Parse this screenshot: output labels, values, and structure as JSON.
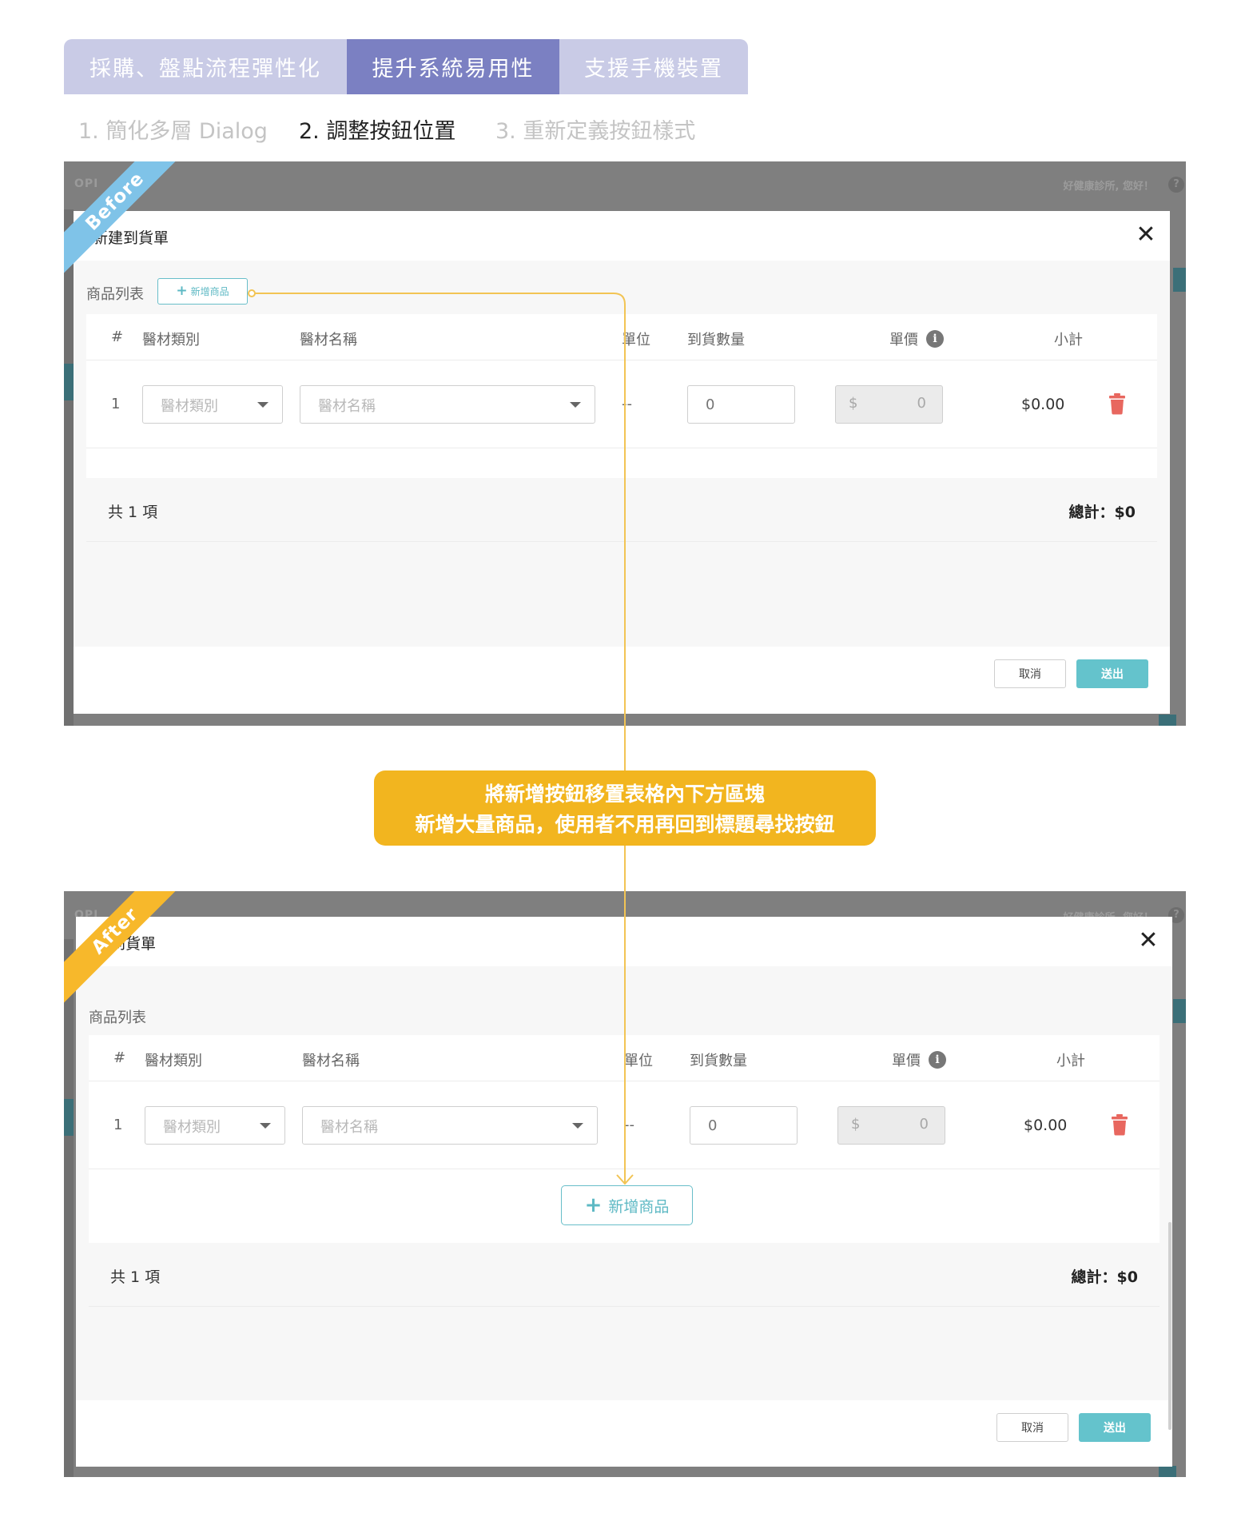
{
  "top_tabs": [
    "採購、盤點流程彈性化",
    "提升系統易用性",
    "支援手機裝置"
  ],
  "sub_steps": [
    "1. 簡化多層 Dialog",
    "2. 調整按鈕位置",
    "3. 重新定義按鈕樣式"
  ],
  "app": {
    "brand": "OPI",
    "greeting": "好健康診所, 您好！",
    "help": "?"
  },
  "before": {
    "ribbon": "Before",
    "dialog_title": "新建到貨單",
    "section_label": "商品列表",
    "add_button": "新增商品"
  },
  "after": {
    "ribbon": "After",
    "dialog_title": "建到貨單",
    "section_label": "商品列表",
    "add_button": "新增商品"
  },
  "table": {
    "headers": [
      "#",
      "醫材類別",
      "醫材名稱",
      "單位",
      "到貨數量",
      "單價",
      "小計"
    ],
    "row": {
      "index": "1",
      "category_placeholder": "醫材類別",
      "name_placeholder": "醫材名稱",
      "unit": "--",
      "qty_placeholder": "0",
      "currency": "$",
      "price": "0",
      "subtotal": "$0.00"
    }
  },
  "totals": {
    "count": "共 1 項",
    "sum": "總計：$0"
  },
  "footer": {
    "cancel": "取消",
    "submit": "送出"
  },
  "callout": {
    "line1": "將新增按鈕移置表格內下方區塊",
    "line2": "新增大量商品，使用者不用再回到標題尋找按鈕"
  },
  "colors": {
    "accent": "#64c3cc",
    "callout": "#f2b51f",
    "before_ribbon": "#7fc3e8",
    "after_ribbon": "#f7b82b",
    "tab_active": "#7b80c2",
    "tab_inactive": "#c9cbe6",
    "delete": "#e8675f"
  }
}
